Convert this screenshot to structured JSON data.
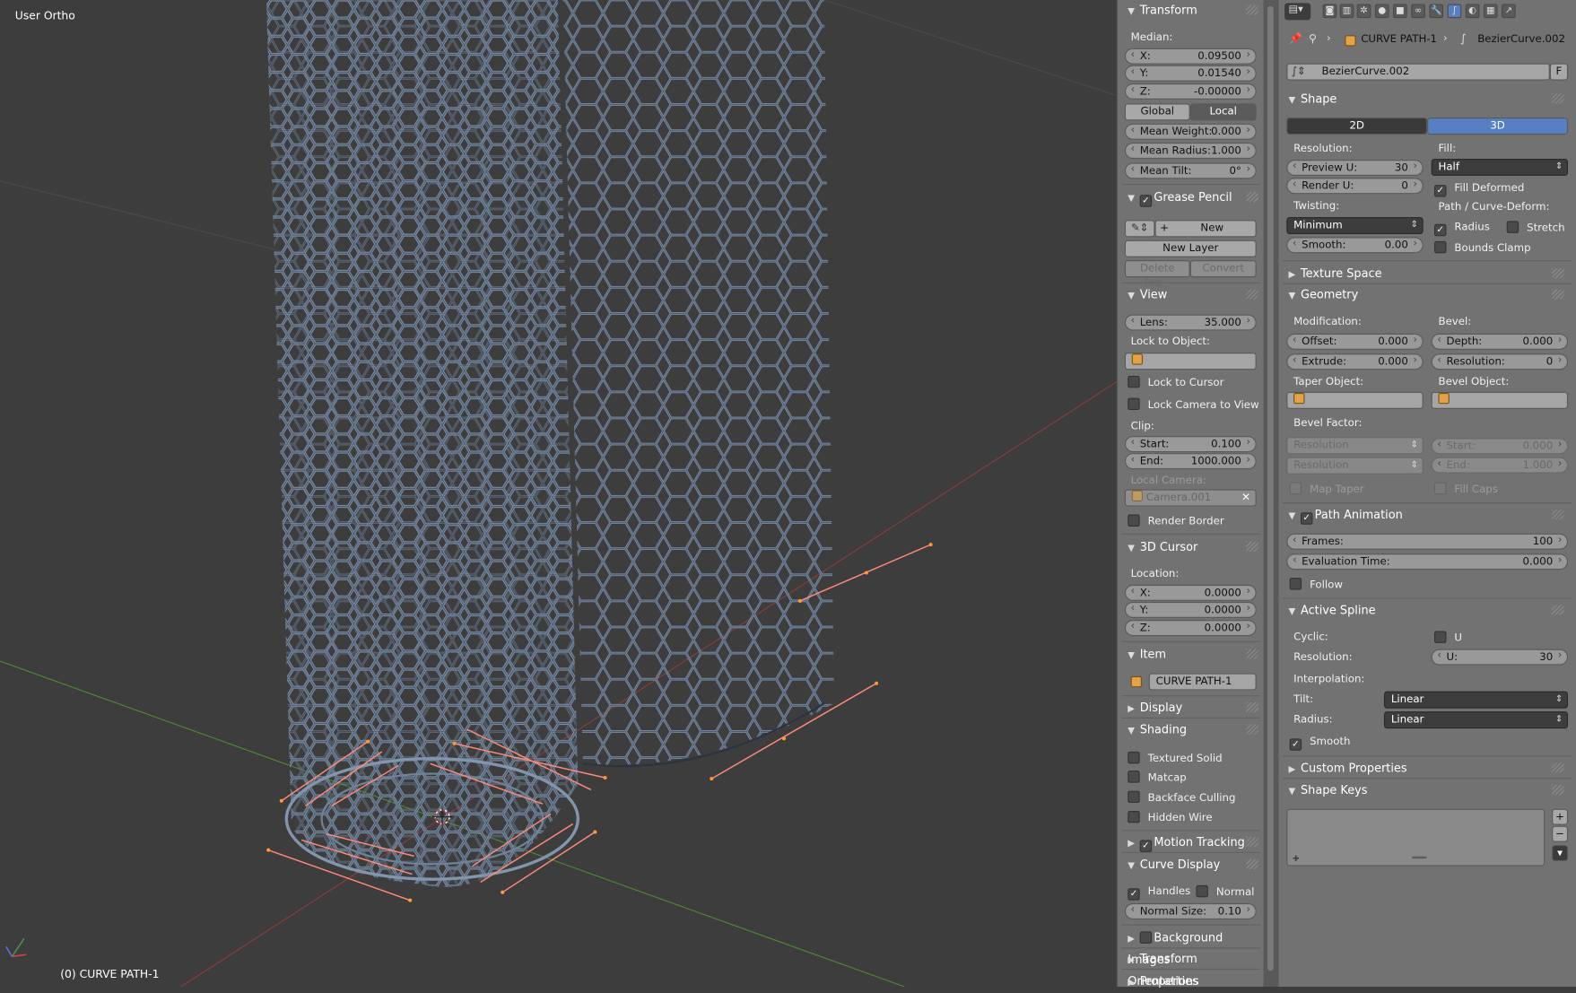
{
  "viewport": {
    "view_name": "User Ortho",
    "object_label": "(0) CURVE PATH-1",
    "axis_icon": "axis-gizmo-icon",
    "cursor_icon": "3d-cursor-icon"
  },
  "npanel": {
    "transform": {
      "title": "Transform",
      "median_label": "Median:",
      "x": {
        "label": "X:",
        "value": "0.09500"
      },
      "y": {
        "label": "Y:",
        "value": "0.01540"
      },
      "z": {
        "label": "Z:",
        "value": "-0.00000"
      },
      "global": "Global",
      "local": "Local",
      "mean_weight": {
        "label": "Mean Weight:",
        "value": "0.000"
      },
      "mean_radius": {
        "label": "Mean Radius:",
        "value": "1.000"
      },
      "mean_tilt": {
        "label": "Mean Tilt:",
        "value": "0°"
      }
    },
    "grease_pencil": {
      "title": "Grease Pencil",
      "new": "New",
      "new_layer": "New Layer",
      "delete_frame": "Delete Fra...",
      "convert": "Convert"
    },
    "view": {
      "title": "View",
      "lens": {
        "label": "Lens:",
        "value": "35.000"
      },
      "lock_to_object": "Lock to Object:",
      "lock_to_cursor": "Lock to Cursor",
      "lock_camera": "Lock Camera to View",
      "clip": "Clip:",
      "start": {
        "label": "Start:",
        "value": "0.100"
      },
      "end": {
        "label": "End:",
        "value": "1000.000"
      },
      "local_camera": "Local Camera:",
      "camera_value": "Camera.001",
      "render_border": "Render Border"
    },
    "cursor": {
      "title": "3D Cursor",
      "location": "Location:",
      "x": {
        "label": "X:",
        "value": "0.0000"
      },
      "y": {
        "label": "Y:",
        "value": "0.0000"
      },
      "z": {
        "label": "Z:",
        "value": "0.0000"
      }
    },
    "item": {
      "title": "Item",
      "name": "CURVE PATH-1"
    },
    "display": {
      "title": "Display"
    },
    "shading": {
      "title": "Shading",
      "textured_solid": "Textured Solid",
      "matcap": "Matcap",
      "backface": "Backface Culling",
      "hidden_wire": "Hidden Wire"
    },
    "motion_tracking": {
      "title": "Motion Tracking"
    },
    "curve_display": {
      "title": "Curve Display",
      "handles": "Handles",
      "normal": "Normal",
      "normal_size": {
        "label": "Normal Size:",
        "value": "0.10"
      }
    },
    "background_images": {
      "title": "Background Images"
    },
    "transform_orientations": {
      "title": "Transform Orientations"
    },
    "properties": {
      "title": "Properties"
    }
  },
  "props": {
    "breadcrumb": {
      "object": "CURVE PATH-1",
      "data": "BezierCurve.002"
    },
    "datablock": {
      "name": "BezierCurve.002",
      "fake_user": "F"
    },
    "shape": {
      "title": "Shape",
      "btn_2d": "2D",
      "btn_3d": "3D",
      "resolution": "Resolution:",
      "preview_u": {
        "label": "Preview U:",
        "value": "30"
      },
      "render_u": {
        "label": "Render U:",
        "value": "0"
      },
      "fill_label": "Fill:",
      "fill_value": "Half",
      "fill_deformed": "Fill Deformed",
      "twisting": "Twisting:",
      "twisting_value": "Minimum",
      "smooth": {
        "label": "Smooth:",
        "value": "0.00"
      },
      "path_deform": "Path / Curve-Deform:",
      "radius": "Radius",
      "stretch": "Stretch",
      "bounds_clamp": "Bounds Clamp"
    },
    "texture_space": {
      "title": "Texture Space"
    },
    "geometry": {
      "title": "Geometry",
      "modification": "Modification:",
      "offset": {
        "label": "Offset:",
        "value": "0.000"
      },
      "extrude": {
        "label": "Extrude:",
        "value": "0.000"
      },
      "bevel": "Bevel:",
      "depth": {
        "label": "Depth:",
        "value": "0.000"
      },
      "resolution": {
        "label": "Resolution:",
        "value": "0"
      },
      "taper_object": "Taper Object:",
      "bevel_object": "Bevel Object:",
      "bevel_factor": "Bevel Factor:",
      "resolution_sel": "Resolution",
      "start": {
        "label": "Start:",
        "value": "0.000"
      },
      "end": {
        "label": "End:",
        "value": "1.000"
      },
      "map_taper": "Map Taper",
      "fill_caps": "Fill Caps"
    },
    "path_animation": {
      "title": "Path Animation",
      "frames": {
        "label": "Frames:",
        "value": "100"
      },
      "eval_time": {
        "label": "Evaluation Time:",
        "value": "0.000"
      },
      "follow": "Follow"
    },
    "active_spline": {
      "title": "Active Spline",
      "cyclic": "Cyclic:",
      "u": "U",
      "resolution": "Resolution:",
      "u_res": {
        "label": "U:",
        "value": "30"
      },
      "interpolation": "Interpolation:",
      "tilt": "Tilt:",
      "tilt_value": "Linear",
      "radius": "Radius:",
      "radius_value": "Linear",
      "smooth": "Smooth"
    },
    "custom_properties": {
      "title": "Custom Properties"
    },
    "shape_keys": {
      "title": "Shape Keys"
    }
  }
}
